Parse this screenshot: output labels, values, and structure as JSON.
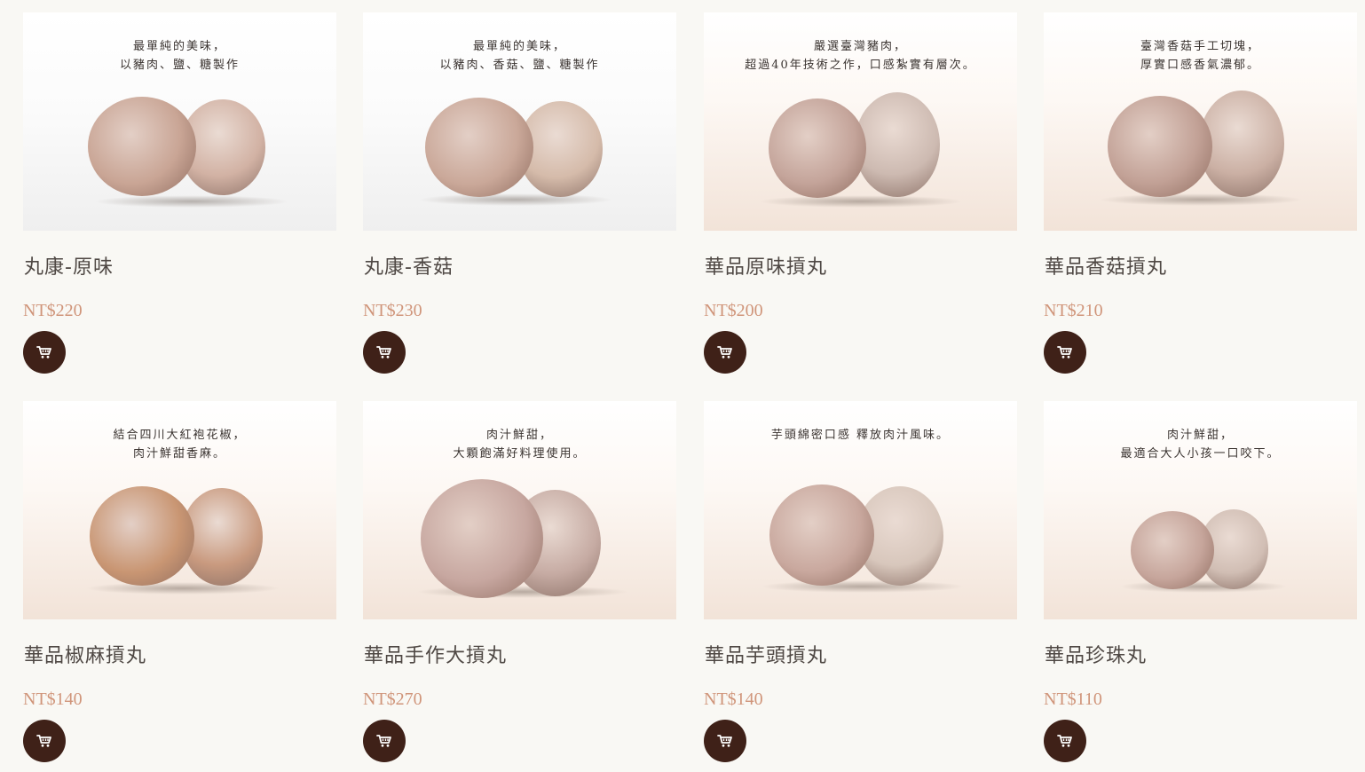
{
  "products": [
    {
      "tagline": "最單純的美味，\n以豬肉、鹽、糖製作",
      "name": "丸康-原味",
      "price": "NT$220",
      "image_bg": "white",
      "ball_color": "#c9a595",
      "ball_color2": "#d2b2a4"
    },
    {
      "tagline": "最單純的美味，\n以豬肉、香菇、鹽、糖製作",
      "name": "丸康-香菇",
      "price": "NT$230",
      "image_bg": "white",
      "ball_color": "#caa899",
      "ball_color2": "#d5bbaa"
    },
    {
      "tagline": "嚴選臺灣豬肉，\n超過40年技術之作，口感紮實有層次。",
      "name": "華品原味摃丸",
      "price": "NT$200",
      "image_bg": "peach",
      "ball_color": "#c4a49a",
      "ball_color2": "#cdbab1"
    },
    {
      "tagline": "臺灣香菇手工切塊，\n厚實口感香氣濃郁。",
      "name": "華品香菇摃丸",
      "price": "NT$210",
      "image_bg": "peach",
      "ball_color": "#c2a196",
      "ball_color2": "#cbb0a4"
    },
    {
      "tagline": "結合四川大紅袍花椒，\n肉汁鮮甜香麻。",
      "name": "華品椒麻摃丸",
      "price": "NT$140",
      "image_bg": "peach",
      "ball_color": "#c99673",
      "ball_color2": "#c99a7f"
    },
    {
      "tagline": "肉汁鮮甜，\n大顆飽滿好料理使用。",
      "name": "華品手作大摃丸",
      "price": "NT$270",
      "image_bg": "peach",
      "ball_color": "#c7a7a0",
      "ball_color2": "#c6aba3"
    },
    {
      "tagline": "芋頭綿密口感 釋放肉汁風味。",
      "name": "華品芋頭摃丸",
      "price": "NT$140",
      "image_bg": "peach",
      "ball_color": "#c9a89e",
      "ball_color2": "#d8c7bc"
    },
    {
      "tagline": "肉汁鮮甜，\n最適合大人小孩一口咬下。",
      "name": "華品珍珠丸",
      "price": "NT$110",
      "image_bg": "peach",
      "ball_color": "#c6a59b",
      "ball_color2": "#d1beb4"
    }
  ]
}
